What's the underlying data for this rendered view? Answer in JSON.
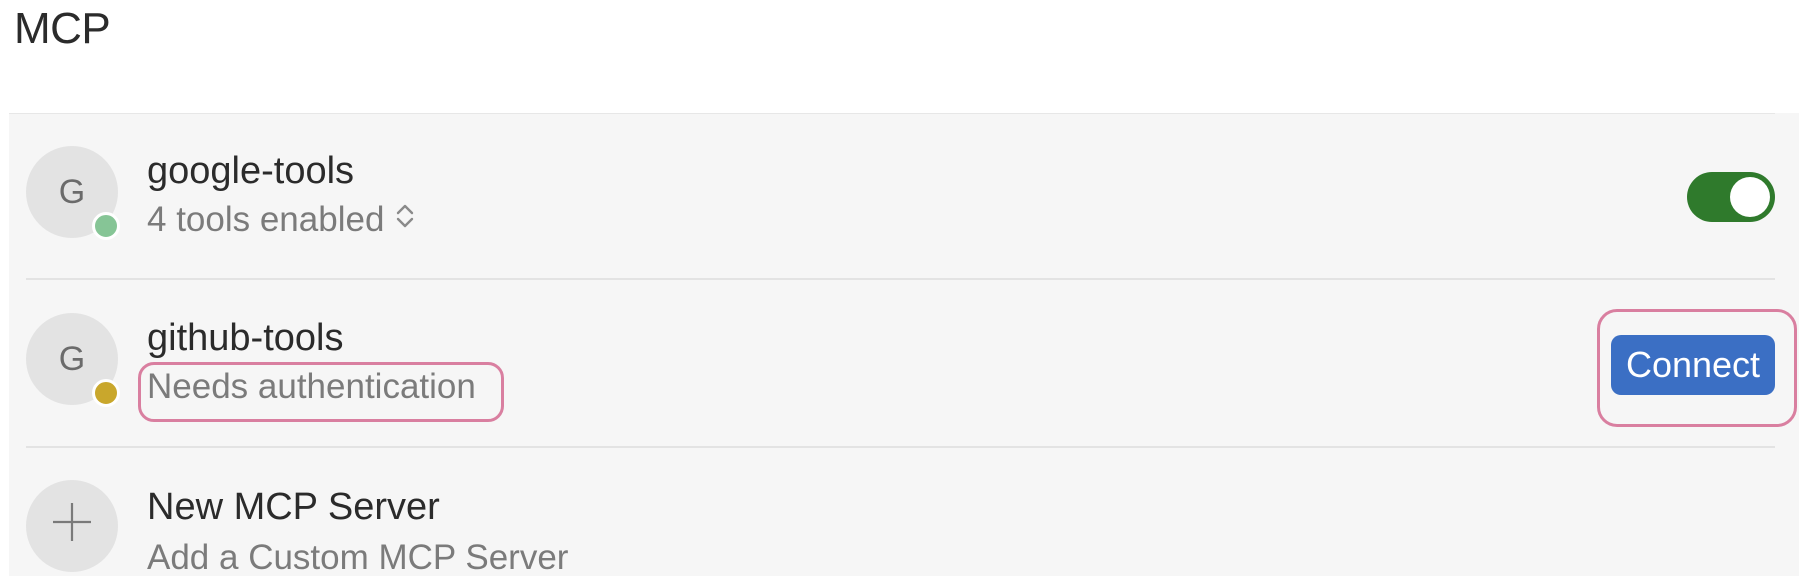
{
  "page": {
    "title": "MCP"
  },
  "servers": [
    {
      "avatar_letter": "G",
      "name": "google-tools",
      "subtitle": "4 tools enabled",
      "status": "connected",
      "status_color": "#86c596",
      "control": "toggle",
      "toggle_on": true,
      "toggle_color": "#2f7a2c",
      "subtitle_icon": "chevron-up-down-icon"
    },
    {
      "avatar_letter": "G",
      "name": "github-tools",
      "subtitle": "Needs authentication",
      "status": "needs-auth",
      "status_color": "#c9a72c",
      "control": "button",
      "button_label": "Connect",
      "button_color": "#3b6fc4",
      "highlight_color": "#d97fa0"
    }
  ],
  "new_server": {
    "icon": "plus-icon",
    "title": "New MCP Server",
    "subtitle": "Add a Custom MCP Server"
  }
}
